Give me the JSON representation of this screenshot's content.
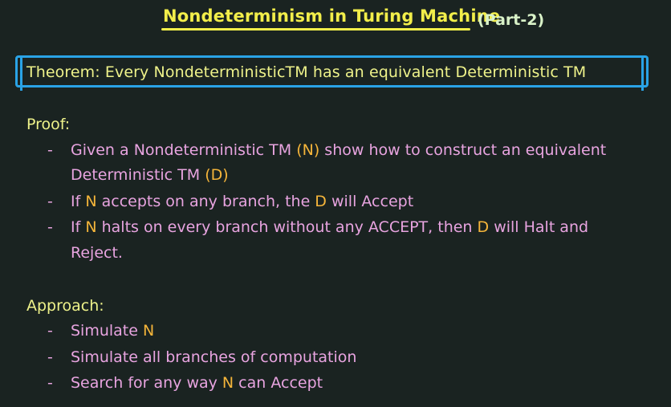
{
  "title": "Nondeterminism in Turing Machine",
  "subtitle": "(Part-2)",
  "theorem": "Theorem: Every NondeterministicTM has an equivalent Deterministic TM",
  "proof": {
    "heading": "Proof:",
    "bullets": [
      {
        "line1": {
          "a": "Given a Nondeterministic TM ",
          "b": "(N)",
          "c": " show how to construct an equivalent"
        },
        "line2": {
          "a": "Deterministic TM ",
          "b": "(D)"
        }
      },
      {
        "a": "If ",
        "b": "N",
        "c": " accepts on any branch, the ",
        "d": "D",
        "e": " will Accept"
      },
      {
        "line1": {
          "a": "If ",
          "b": "N",
          "c": " halts on every branch without any ACCEPT, then ",
          "d": "D",
          "e": " will Halt and"
        },
        "line2": "Reject."
      }
    ]
  },
  "approach": {
    "heading": "Approach:",
    "bullets": [
      {
        "a": "Simulate ",
        "b": "N"
      },
      {
        "a": "Simulate all branches of computation"
      },
      {
        "a": "Search for any way ",
        "b": "N",
        "c": " can Accept"
      }
    ]
  },
  "dash": "-",
  "colors": {
    "background": "#1a2321",
    "title": "#f2ee4a",
    "box_border": "#2aa3e6",
    "text_yellow": "#eef28a",
    "text_pink": "#e8a4e0",
    "highlight_orange": "#f5b53a"
  }
}
